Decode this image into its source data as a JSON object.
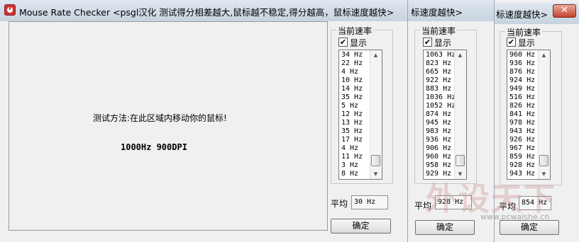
{
  "window1": {
    "title": "Mouse Rate Checker <psgl汉化  测试得分相差越大,鼠标越不稳定,得分越高，鼠标速度越快>",
    "minimize_glyph": "_",
    "instruction": "测试方法:在此区域内移动你的鼠标!",
    "device_info": "1000Hz 900DPI",
    "rate_group_label": "当前速率",
    "show_label": "显示",
    "show_checked": "✔",
    "rates": [
      "34 Hz",
      "22 Hz",
      "4 Hz",
      "10 Hz",
      "14 Hz",
      "35 Hz",
      "5 Hz",
      "12 Hz",
      "13 Hz",
      "35 Hz",
      "17 Hz",
      "4 Hz",
      "11 Hz",
      "3 Hz",
      "8 Hz"
    ],
    "avg_label": "平均",
    "avg_value": "30 Hz",
    "ok_label": "确定"
  },
  "window2": {
    "title": "标速度越快>",
    "rate_group_label": "当前速率",
    "show_label": "显示",
    "show_checked": "✔",
    "rates": [
      "1063 Hz",
      "823 Hz",
      "665 Hz",
      "922 Hz",
      "883 Hz",
      "1036 Hz",
      "1052 Hz",
      "874 Hz",
      "945 Hz",
      "983 Hz",
      "936 Hz",
      "906 Hz",
      "960 Hz",
      "958 Hz",
      "929 Hz"
    ],
    "avg_label": "平均",
    "avg_value": "928 Hz",
    "ok_label": "确定"
  },
  "window3": {
    "title": "标速度越快>",
    "close_glyph": "✕",
    "rate_group_label": "当前速率",
    "show_label": "显示",
    "show_checked": "✔",
    "rates": [
      "960 Hz",
      "936 Hz",
      "876 Hz",
      "924 Hz",
      "949 Hz",
      "516 Hz",
      "826 Hz",
      "841 Hz",
      "978 Hz",
      "943 Hz",
      "926 Hz",
      "967 Hz",
      "859 Hz",
      "928 Hz",
      "943 Hz"
    ],
    "avg_label": "平均",
    "avg_value": "854 Hz",
    "ok_label": "确定"
  },
  "watermark": {
    "logo": "外设天下",
    "url": "www.pcwaishe.cn"
  }
}
